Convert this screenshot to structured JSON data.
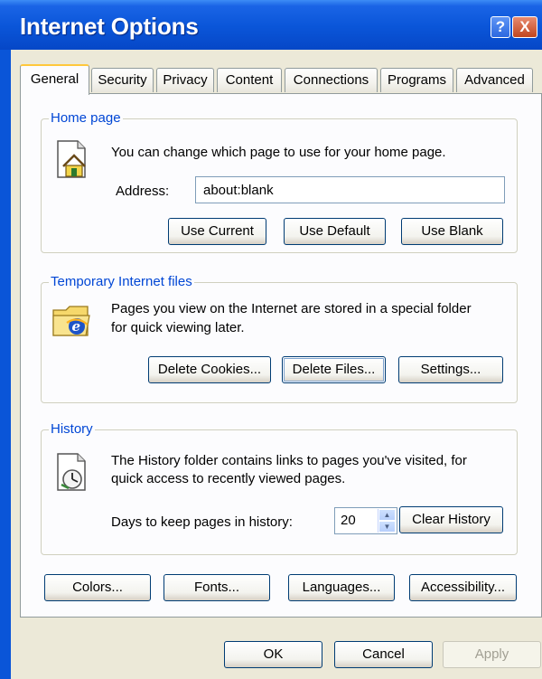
{
  "window": {
    "title": "Internet Options",
    "help_glyph": "?",
    "close_glyph": "X"
  },
  "tabs": [
    {
      "label": "General",
      "active": true
    },
    {
      "label": "Security",
      "active": false
    },
    {
      "label": "Privacy",
      "active": false
    },
    {
      "label": "Content",
      "active": false
    },
    {
      "label": "Connections",
      "active": false
    },
    {
      "label": "Programs",
      "active": false
    },
    {
      "label": "Advanced",
      "active": false
    }
  ],
  "home_page": {
    "group_label": "Home page",
    "description": "You can change which page to use for your home page.",
    "address_label": "Address:",
    "address_value": "about:blank",
    "use_current": "Use Current",
    "use_default": "Use Default",
    "use_blank": "Use Blank",
    "icon": "home-page-icon"
  },
  "temp_files": {
    "group_label": "Temporary Internet files",
    "description_line1": "Pages you view on the Internet are stored in a special folder",
    "description_line2": "for quick viewing later.",
    "delete_cookies": "Delete Cookies...",
    "delete_files": "Delete Files...",
    "settings": "Settings...",
    "icon": "ie-folder-icon"
  },
  "history": {
    "group_label": "History",
    "description_line1": "The History folder contains links to pages you've visited, for",
    "description_line2": "quick access to recently viewed pages.",
    "days_label": "Days to keep pages in history:",
    "days_value": "20",
    "clear_history": "Clear History",
    "icon": "history-clock-icon"
  },
  "bottom_buttons": {
    "colors": "Colors...",
    "fonts": "Fonts...",
    "languages": "Languages...",
    "accessibility": "Accessibility..."
  },
  "dialog_buttons": {
    "ok": "OK",
    "cancel": "Cancel",
    "apply": "Apply"
  },
  "colors": {
    "titlebar": "#0a55d8",
    "dialog_bg": "#ece9d8",
    "group_label": "#0046d5",
    "active_tab_accent": "#ffc83c"
  }
}
